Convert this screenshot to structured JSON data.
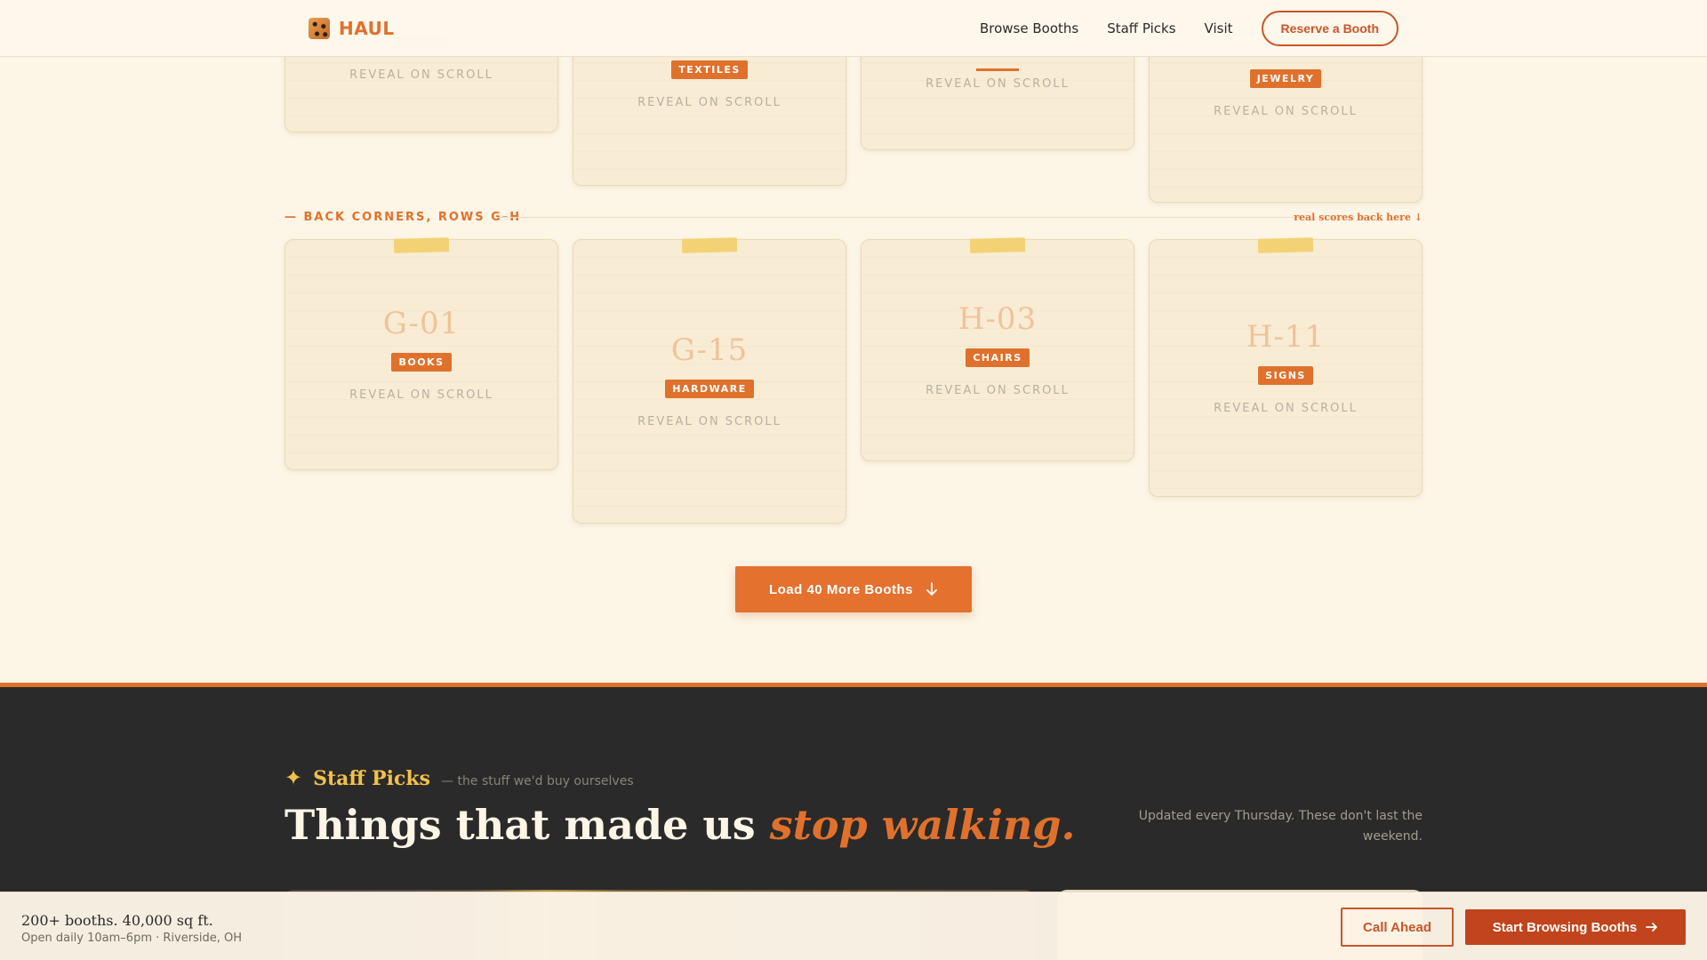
{
  "nav": {
    "brand": "HAUL",
    "links": [
      "Browse Booths",
      "Staff Picks",
      "Visit"
    ],
    "cta": "Reserve a Booth"
  },
  "top_row": [
    {
      "category": "",
      "reveal": "REVEAL ON SCROLL"
    },
    {
      "category": "TEXTILES",
      "reveal": "REVEAL ON SCROLL"
    },
    {
      "category": "",
      "reveal": "REVEAL ON SCROLL"
    },
    {
      "category": "JEWELRY",
      "reveal": "REVEAL ON SCROLL"
    }
  ],
  "section": {
    "label": "— BACK CORNERS, ROWS G–H",
    "note": "real scores back here ↓"
  },
  "booths": [
    {
      "id": "G-01",
      "category": "BOOKS",
      "reveal": "REVEAL ON SCROLL"
    },
    {
      "id": "G-15",
      "category": "HARDWARE",
      "reveal": "REVEAL ON SCROLL"
    },
    {
      "id": "H-03",
      "category": "CHAIRS",
      "reveal": "REVEAL ON SCROLL"
    },
    {
      "id": "H-11",
      "category": "SIGNS",
      "reveal": "REVEAL ON SCROLL"
    }
  ],
  "load_more": {
    "label": "Load 40 More Booths",
    "icon": "arrow-down-icon"
  },
  "staff_picks": {
    "kicker": "Staff Picks",
    "kicker_icon": "sparkle-icon",
    "subtitle": "— the stuff we'd buy ourselves",
    "headline": "Things that made us ",
    "headline_em": "stop walking.",
    "note": "Updated every Thursday. These don't last the weekend."
  },
  "sticky": {
    "main": "200+ booths. 40,000 sq ft.",
    "sub": "Open daily 10am–6pm · Riverside, OH",
    "call": "Call Ahead",
    "browse": "Start Browsing Booths",
    "browse_icon": "arrow-right-icon"
  },
  "colors": {
    "accent": "#e0712c",
    "accent_dark": "#c1441c",
    "gold": "#f2c04a",
    "cream": "#fdf5e6",
    "dark": "#2a2a2a"
  }
}
